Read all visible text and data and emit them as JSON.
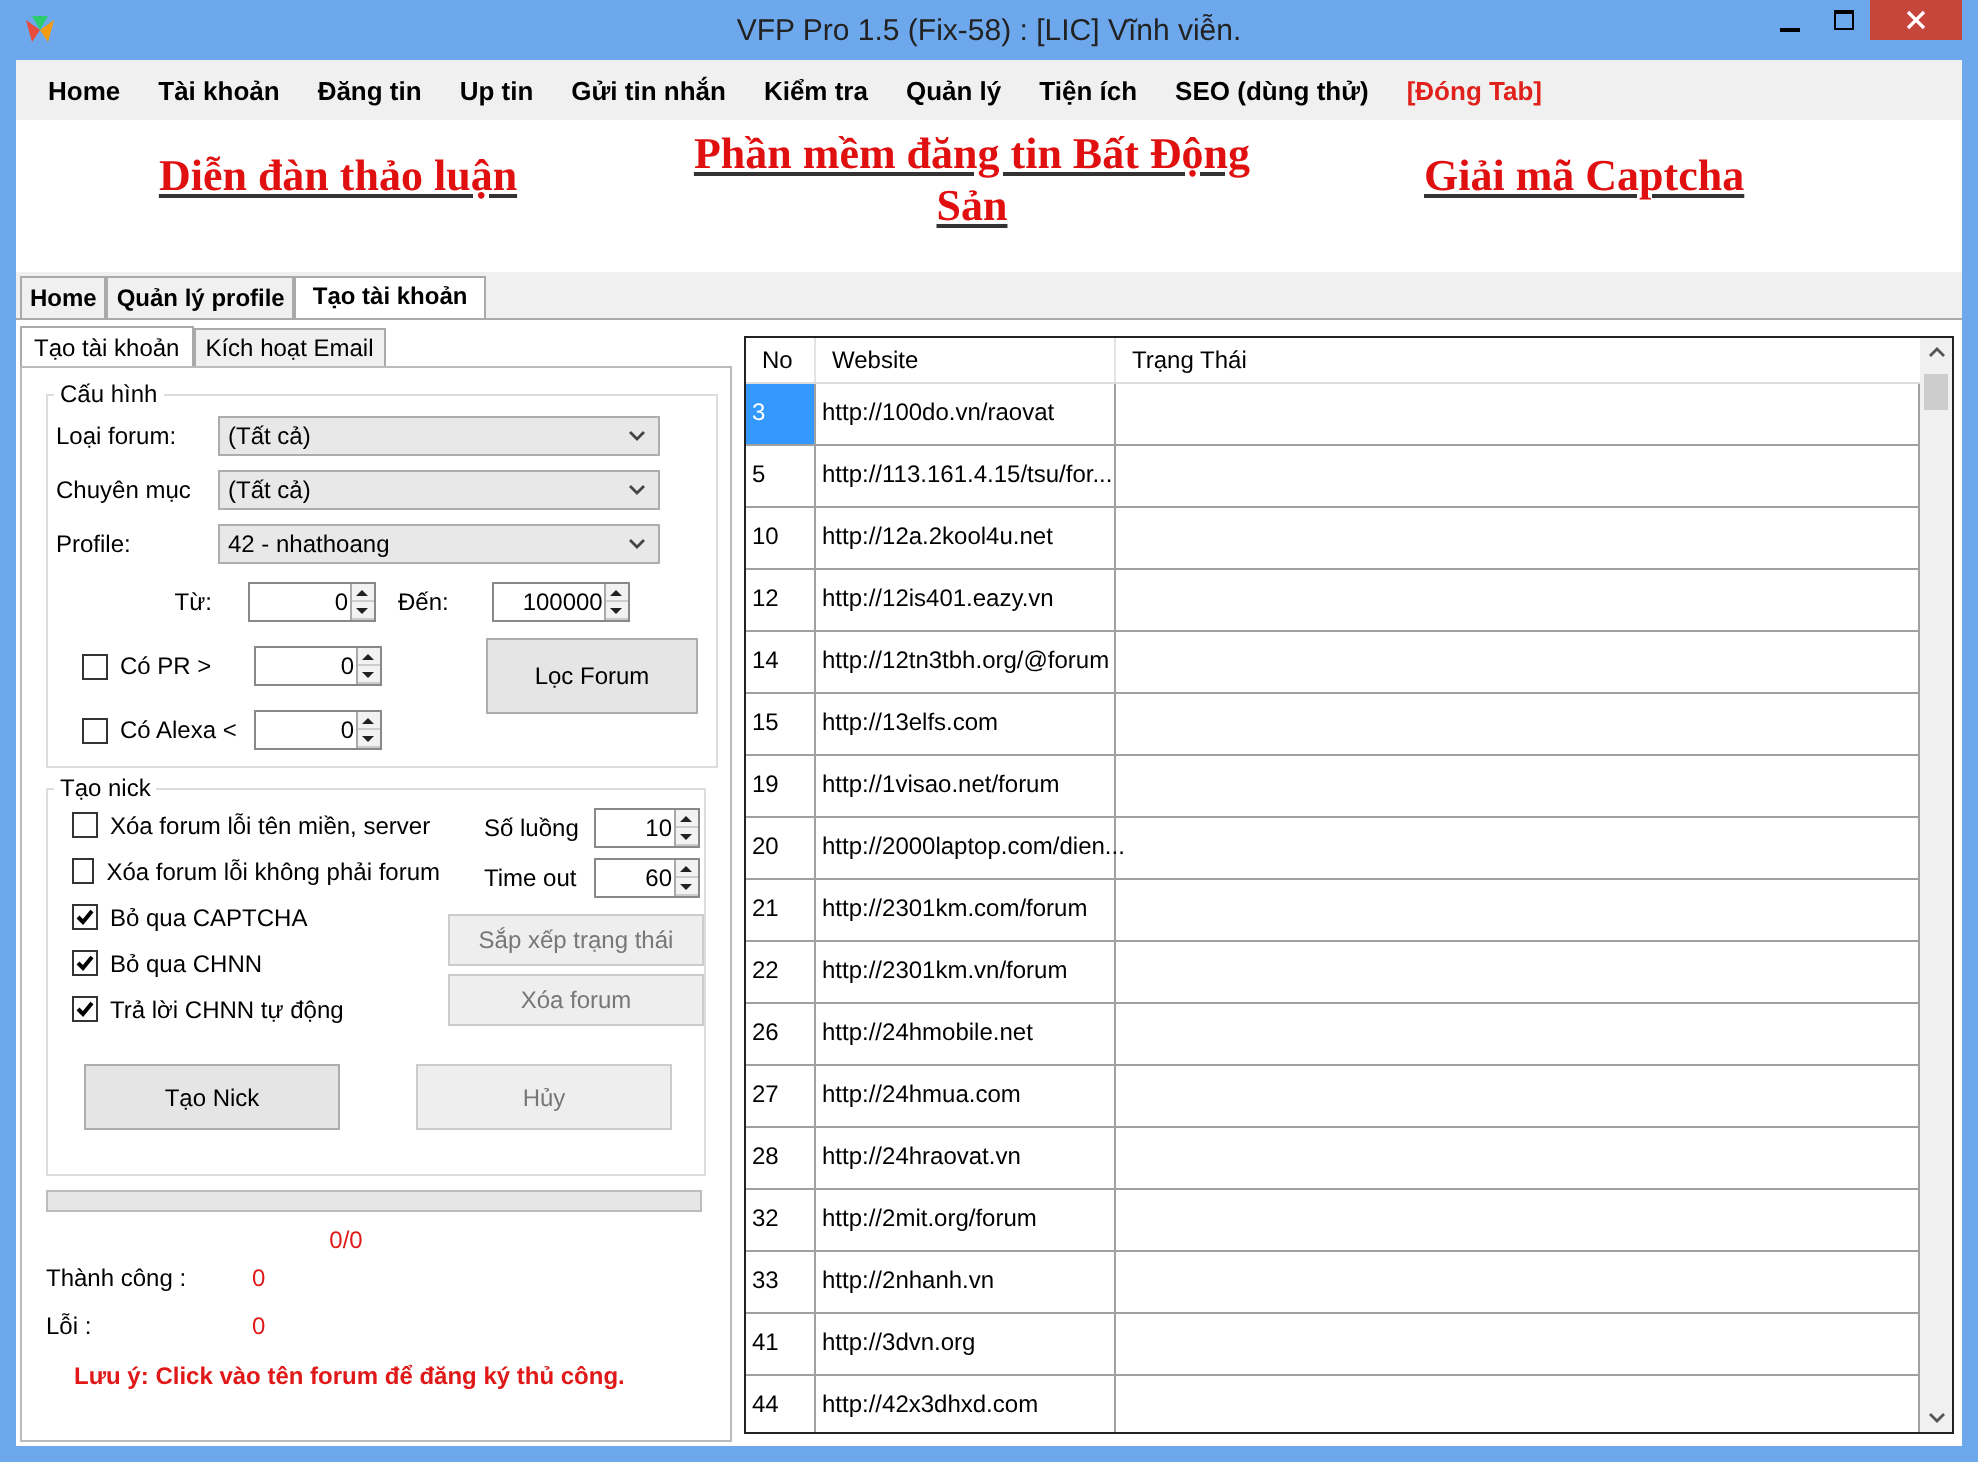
{
  "window": {
    "title": "VFP Pro 1.5 (Fix-58) : [LIC] Vĩnh viễn."
  },
  "menu": [
    {
      "label": "Home",
      "kind": "normal"
    },
    {
      "label": "Tài khoản",
      "kind": "normal"
    },
    {
      "label": "Đăng tin",
      "kind": "normal"
    },
    {
      "label": "Up tin",
      "kind": "normal"
    },
    {
      "label": "Gửi tin nhắn",
      "kind": "normal"
    },
    {
      "label": "Kiểm tra",
      "kind": "normal"
    },
    {
      "label": "Quản lý",
      "kind": "normal"
    },
    {
      "label": "Tiện ích",
      "kind": "normal"
    },
    {
      "label": "SEO (dùng thử)",
      "kind": "normal"
    },
    {
      "label": "[Đóng Tab]",
      "kind": "warning"
    }
  ],
  "banner_links": [
    "Diễn đàn thảo luận",
    "Phần mềm đăng tin Bất Động Sản",
    "Giải mã Captcha"
  ],
  "tabs": [
    {
      "label": "Home",
      "selected": false
    },
    {
      "label": "Quản lý profile",
      "selected": false
    },
    {
      "label": "Tạo tài khoản",
      "selected": true
    }
  ],
  "subtabs": [
    {
      "label": "Tạo tài khoản",
      "selected": true
    },
    {
      "label": "Kích hoạt Email",
      "selected": false
    }
  ],
  "config": {
    "title": "Cấu hình",
    "dropdowns": [
      {
        "label": "Loại forum:",
        "value": "(Tất cả)"
      },
      {
        "label": "Chuyên mục",
        "value": "(Tất cả)"
      },
      {
        "label": "Profile:",
        "value": "42 - nhathoang"
      }
    ],
    "from_label": "Từ:",
    "from_value": "0",
    "to_label": "Đến:",
    "to_value": "100000",
    "filters": [
      {
        "label": "Có PR >",
        "checked": false,
        "value": "0"
      },
      {
        "label": "Có Alexa <",
        "checked": false,
        "value": "0"
      }
    ],
    "filter_button": "Lọc Forum"
  },
  "nick": {
    "title": "Tạo nick",
    "options": [
      {
        "label": "Xóa forum lỗi tên miền, server",
        "checked": false
      },
      {
        "label": "Xóa forum lỗi không phải forum",
        "checked": false
      },
      {
        "label": "Bỏ qua CAPTCHA",
        "checked": true
      },
      {
        "label": "Bỏ qua CHNN",
        "checked": true
      },
      {
        "label": "Trả lời CHNN tự động",
        "checked": true
      }
    ],
    "threads_label": "Số luồng",
    "threads_value": "10",
    "timeout_label": "Time out",
    "timeout_value": "60",
    "buttons": [
      {
        "label": "Sắp xếp trạng thái",
        "disabled": true
      },
      {
        "label": "Xóa forum",
        "disabled": true
      }
    ],
    "create_button": {
      "label": "Tạo Nick",
      "disabled": false
    },
    "cancel_button": {
      "label": "Hủy",
      "disabled": true
    }
  },
  "progress": {
    "level": 0
  },
  "counter": "0/0",
  "stats": [
    {
      "label": "Thành công :",
      "value": "0"
    },
    {
      "label": "Lỗi :",
      "value": "0"
    }
  ],
  "note": "Lưu ý: Click vào tên forum để đăng ký thủ công.",
  "table": {
    "columns": [
      "No",
      "Website",
      "Trạng Thái"
    ],
    "rows": [
      {
        "no": "3",
        "website": "http://100do.vn/raovat",
        "selected": true
      },
      {
        "no": "5",
        "website": "http://113.161.4.15/tsu/for...",
        "selected": false
      },
      {
        "no": "10",
        "website": "http://12a.2kool4u.net",
        "selected": false
      },
      {
        "no": "12",
        "website": "http://12is401.eazy.vn",
        "selected": false
      },
      {
        "no": "14",
        "website": "http://12tn3tbh.org/@forum",
        "selected": false
      },
      {
        "no": "15",
        "website": "http://13elfs.com",
        "selected": false
      },
      {
        "no": "19",
        "website": "http://1visao.net/forum",
        "selected": false
      },
      {
        "no": "20",
        "website": "http://2000laptop.com/dien...",
        "selected": false
      },
      {
        "no": "21",
        "website": "http://2301km.com/forum",
        "selected": false
      },
      {
        "no": "22",
        "website": "http://2301km.vn/forum",
        "selected": false
      },
      {
        "no": "26",
        "website": "http://24hmobile.net",
        "selected": false
      },
      {
        "no": "27",
        "website": "http://24hmua.com",
        "selected": false
      },
      {
        "no": "28",
        "website": "http://24hraovat.vn",
        "selected": false
      },
      {
        "no": "32",
        "website": "http://2mit.org/forum",
        "selected": false
      },
      {
        "no": "33",
        "website": "http://2nhanh.vn",
        "selected": false
      },
      {
        "no": "41",
        "website": "http://3dvn.org",
        "selected": false
      },
      {
        "no": "44",
        "website": "http://42x3dhxd.com",
        "selected": false
      }
    ]
  }
}
